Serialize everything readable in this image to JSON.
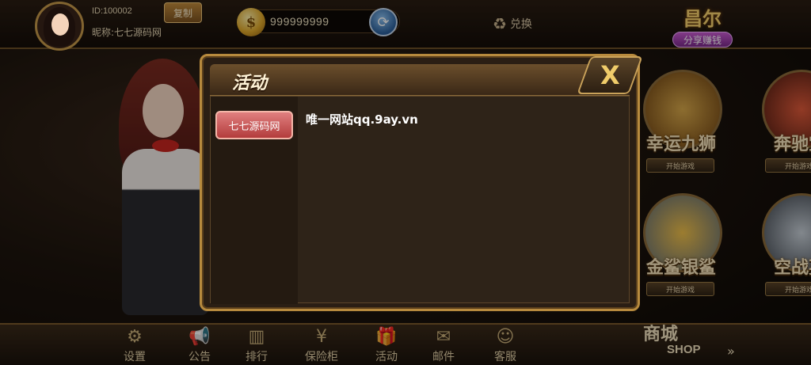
{
  "user": {
    "id_label": "ID:100002",
    "nickname": "昵称:七七源码网",
    "copy_label": "复制"
  },
  "wallet": {
    "coins": "999999999",
    "coin_glyph": "$",
    "refresh_glyph": "⟳"
  },
  "exchange": {
    "label": "兑换",
    "icon": "♻"
  },
  "share": {
    "big_text": "昌尔",
    "pill_label": "分享赚钱"
  },
  "games": [
    {
      "title": "幸运九狮",
      "tag": "开始游戏",
      "color": "#b98a3a"
    },
    {
      "title": "奔驰宝",
      "tag": "开始游戏",
      "color": "#b93a2a"
    },
    {
      "title": "金鲨银鲨",
      "tag": "开始游戏",
      "color": "#d4a53a"
    },
    {
      "title": "空战英",
      "tag": "开始游戏",
      "color": "#6a7a8a"
    }
  ],
  "nav": [
    {
      "label": "设置",
      "icon": "⚙"
    },
    {
      "label": "公告",
      "icon": "📢"
    },
    {
      "label": "排行",
      "icon": "▥"
    },
    {
      "label": "保险柜",
      "icon": "¥"
    },
    {
      "label": "活动",
      "icon": "🎁"
    },
    {
      "label": "邮件",
      "icon": "✉"
    },
    {
      "label": "客服",
      "icon": "☺"
    }
  ],
  "shop": {
    "label_cn": "商城",
    "label_en": "SHOP",
    "arrows": "»"
  },
  "dialog": {
    "title": "活动",
    "close_glyph": "X",
    "tab_label": "七七源码网",
    "notice": "唯一网站qq.9ay.vn"
  }
}
